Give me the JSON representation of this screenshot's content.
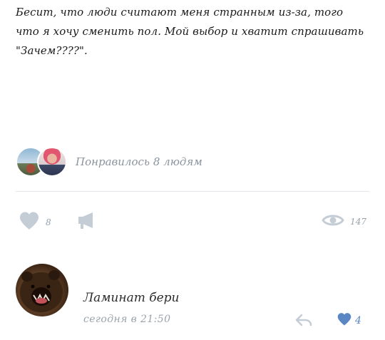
{
  "post": {
    "text_lines": [
      "Бесит, что люди считают меня странным из-за, того",
      "что я хочу сменить пол. Мой выбор и хватит спрашивать",
      "\"Зачем????\"."
    ]
  },
  "likes_summary": {
    "text": "Понравилось 8 людям"
  },
  "actions": {
    "like_count": "8",
    "views_count": "147"
  },
  "comment": {
    "author": "Ламинат бери",
    "time": "сегодня в 21:50",
    "like_count": "4"
  },
  "colors": {
    "icon_gray": "#c4cdd6",
    "like_blue": "#5b86c4",
    "muted_text": "#8a949e",
    "divider": "#e3e6ea"
  },
  "icons": {
    "like": "heart-icon",
    "share": "megaphone-icon",
    "views": "eye-icon",
    "reply": "reply-arrow-icon",
    "comment_like": "heart-icon"
  }
}
